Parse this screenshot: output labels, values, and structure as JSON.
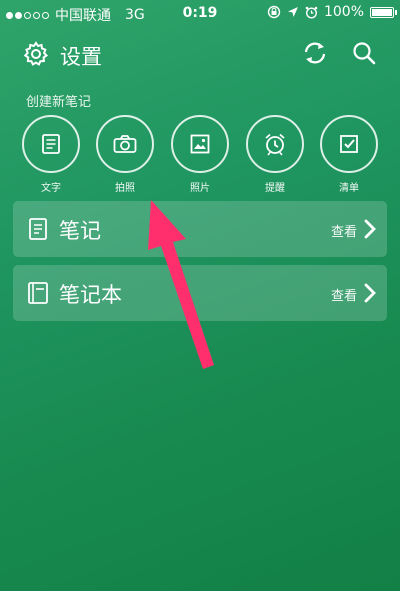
{
  "status_bar": {
    "carrier": "中国联通",
    "network": "3G",
    "time": "0:19",
    "battery": "100%"
  },
  "header": {
    "title": "设置",
    "icons": [
      "gear-icon",
      "sync-icon",
      "search-icon"
    ]
  },
  "create_section": {
    "label": "创建新笔记",
    "items": [
      {
        "label": "文字",
        "icon": "text-note-icon"
      },
      {
        "label": "拍照",
        "icon": "camera-icon"
      },
      {
        "label": "照片",
        "icon": "photo-icon"
      },
      {
        "label": "提醒",
        "icon": "alarm-icon"
      },
      {
        "label": "清单",
        "icon": "checklist-icon"
      }
    ]
  },
  "cards": [
    {
      "title": "笔记",
      "action": "查看",
      "icon": "note-icon"
    },
    {
      "title": "笔记本",
      "action": "查看",
      "icon": "notebook-icon"
    }
  ],
  "colors": {
    "background": "#1f9560",
    "annotation_arrow": "#ff2f6d"
  }
}
